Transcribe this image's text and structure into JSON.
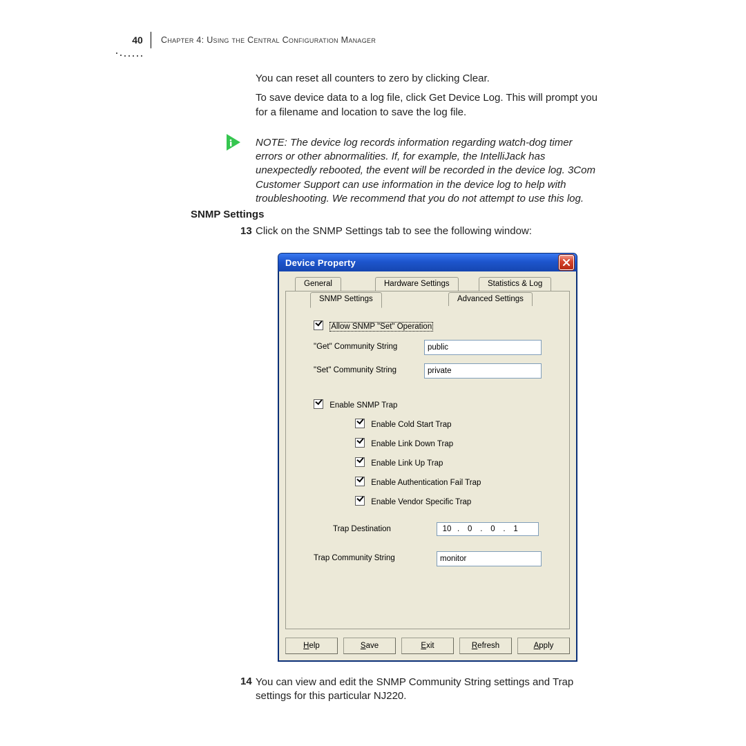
{
  "header": {
    "page_number": "40",
    "running_head": "Chapter 4: Using the Central Configuration Manager"
  },
  "body": {
    "para1": "You can reset all counters to zero by clicking Clear.",
    "para2": "To save device data to a log file, click Get Device Log. This will prompt you for a filename and location to save the log file.",
    "note": "NOTE: The device log records information regarding watch-dog timer errors or other abnormalities. If, for example, the IntelliJack has unexpectedly rebooted, the event will be recorded in the device log. 3Com Customer Support can use information in the device log to help with troubleshooting. We recommend that you do not attempt to use this log.",
    "note_icon_color": "#35c64f"
  },
  "snmp_section": {
    "heading": "SNMP Settings",
    "step13_num": "13",
    "step13_text": "Click on the SNMP Settings tab to see the following window:",
    "step14_num": "14",
    "step14_text": "You can view and edit the SNMP Community String settings and Trap settings for this particular NJ220."
  },
  "dialog": {
    "title": "Device Property",
    "tabs": {
      "general": "General",
      "hardware": "Hardware Settings",
      "stats": "Statistics & Log",
      "snmp": "SNMP Settings",
      "advanced": "Advanced Settings",
      "active": "snmp"
    },
    "fields": {
      "allow_set_label": "Allow SNMP \"Set\" Operation",
      "allow_set_checked": true,
      "get_comm_label": "\"Get\" Community String",
      "get_comm_value": "public",
      "set_comm_label": "\"Set\" Community String",
      "set_comm_value": "private",
      "enable_trap_label": "Enable SNMP Trap",
      "enable_trap_checked": true,
      "cold_start_label": "Enable Cold Start Trap",
      "cold_start_checked": true,
      "link_down_label": "Enable Link Down Trap",
      "link_down_checked": true,
      "link_up_label": "Enable Link Up Trap",
      "link_up_checked": true,
      "auth_fail_label": "Enable Authentication Fail Trap",
      "auth_fail_checked": true,
      "vendor_trap_label": "Enable Vendor Specific Trap",
      "vendor_trap_checked": true,
      "trap_dest_label": "Trap Destination",
      "trap_dest_ip": {
        "o1": "10",
        "o2": "0",
        "o3": "0",
        "o4": "1"
      },
      "trap_comm_label": "Trap Community String",
      "trap_comm_value": "monitor"
    },
    "buttons": {
      "help": "Help",
      "save": "Save",
      "exit": "Exit",
      "refresh": "Refresh",
      "apply": "Apply"
    }
  }
}
